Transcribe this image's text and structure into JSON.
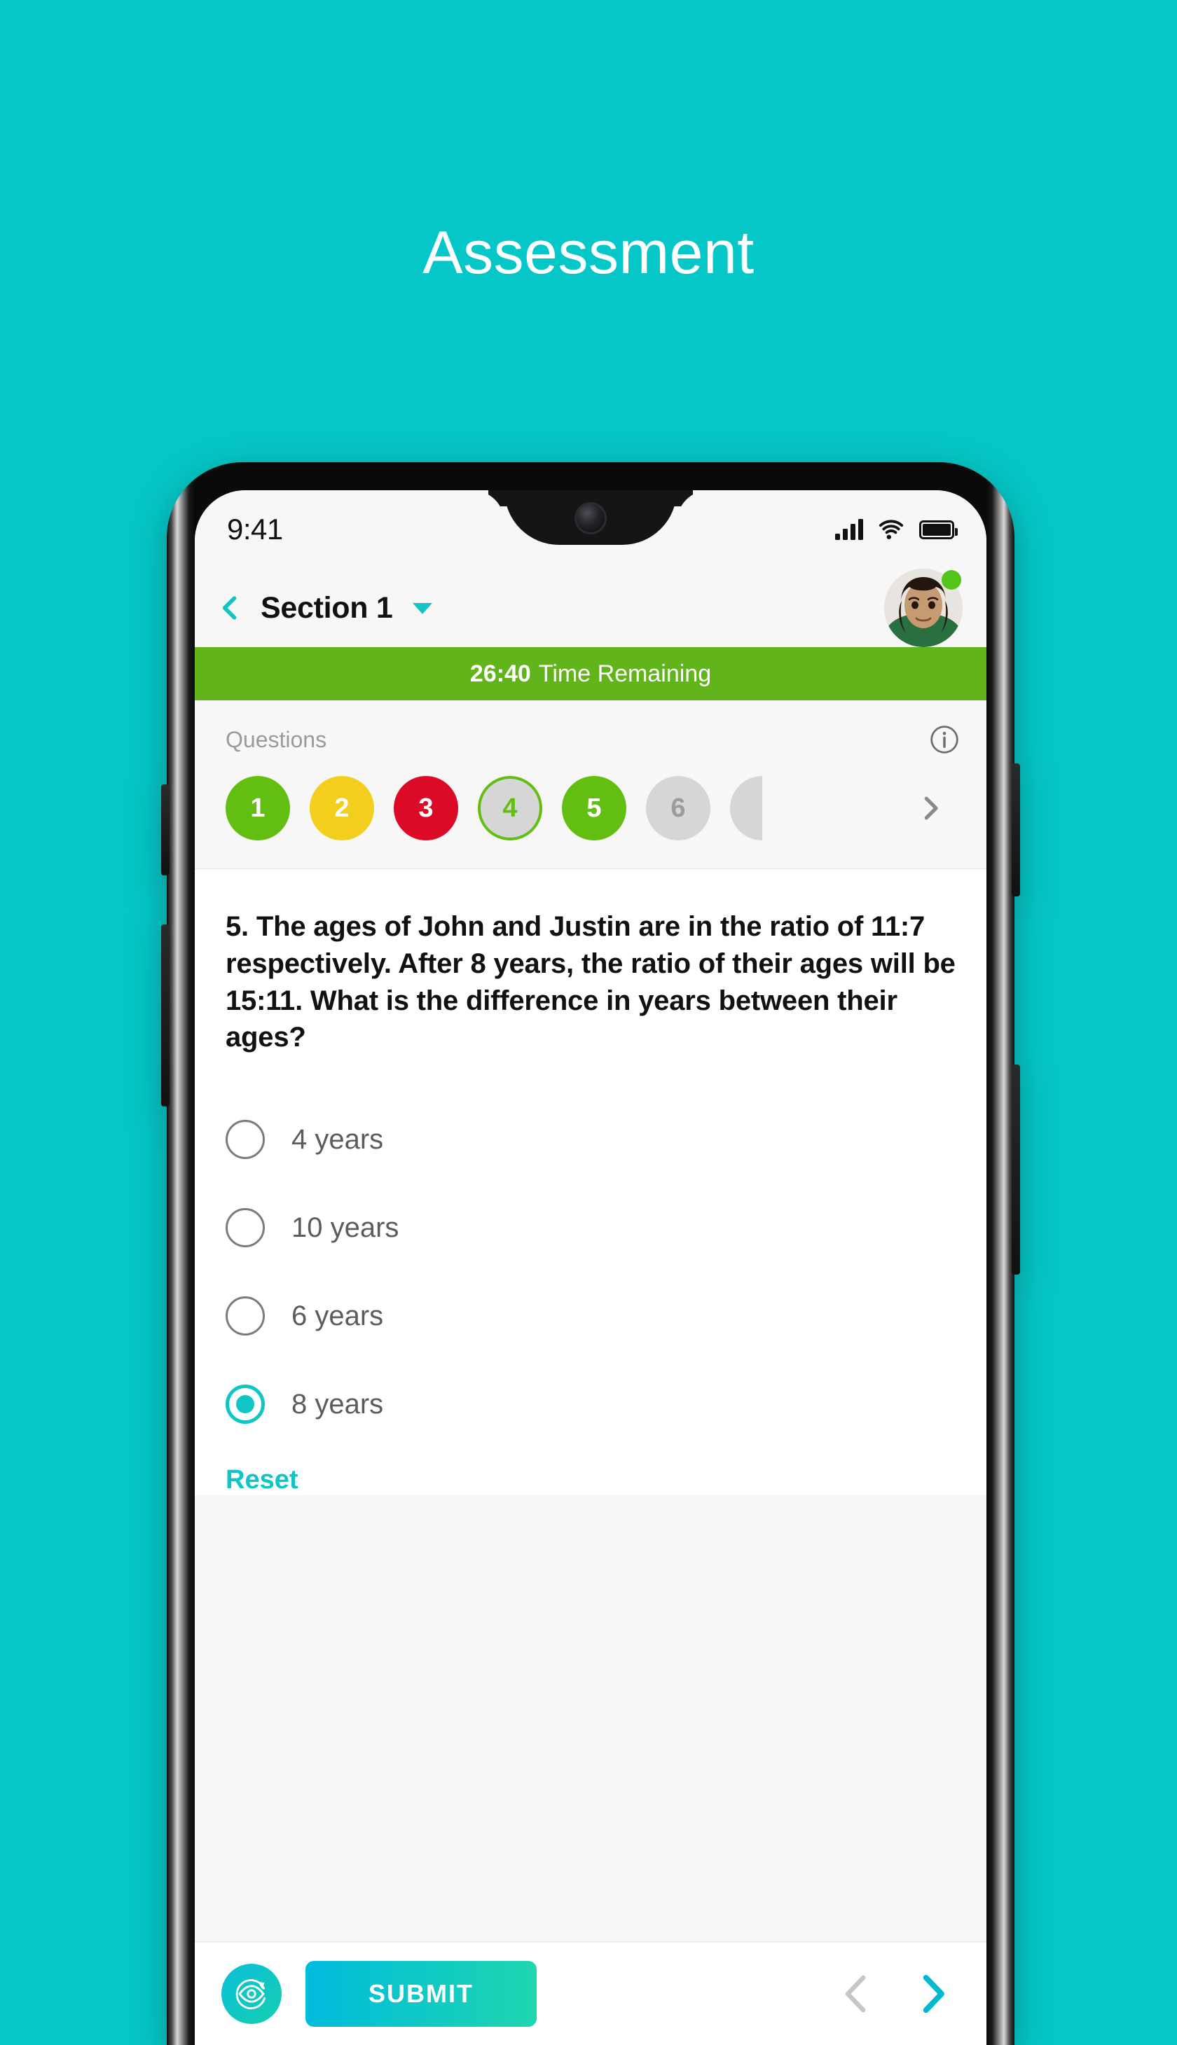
{
  "page": {
    "title": "Assessment",
    "background_color": "#06C7C7"
  },
  "status_bar": {
    "time": "9:41",
    "signal_icon": "signal-bars-icon",
    "wifi_icon": "wifi-icon",
    "battery_icon": "battery-full-icon"
  },
  "nav_bar": {
    "back_icon": "chevron-left-icon",
    "title": "Section 1",
    "dropdown_icon": "caret-down-icon",
    "avatar_icon": "user-avatar",
    "status_dot_color": "#52C41A",
    "accent_color": "#0FC5C5"
  },
  "timer": {
    "value": "26:40",
    "label": "Time Remaining",
    "background_color": "#61B51B"
  },
  "questions_strip": {
    "label": "Questions",
    "info_icon": "info-circle-icon",
    "next_icon": "chevron-right-icon",
    "items": [
      {
        "number": "1",
        "state": "green"
      },
      {
        "number": "2",
        "state": "amber"
      },
      {
        "number": "3",
        "state": "red"
      },
      {
        "number": "4",
        "state": "active"
      },
      {
        "number": "5",
        "state": "green"
      },
      {
        "number": "6",
        "state": "grey"
      },
      {
        "number": "",
        "state": "partial"
      }
    ],
    "colors": {
      "green": "#63BE12",
      "amber": "#F4CE1C",
      "red": "#DC0A26",
      "grey": "#D6D6D6"
    }
  },
  "question": {
    "text": "5. The ages of John and Justin are in the ratio of 11:7 respectively.\nAfter 8 years, the ratio of their ages will be 15:11. What is the difference in years between their ages?",
    "options": [
      {
        "label": "4 years",
        "selected": false
      },
      {
        "label": "10 years",
        "selected": false
      },
      {
        "label": "6 years",
        "selected": false
      },
      {
        "label": "8 years",
        "selected": true
      }
    ],
    "reset_label": "Reset"
  },
  "bottom_bar": {
    "review_icon": "review-eye-icon",
    "submit_label": "SUBMIT",
    "prev_icon": "chevron-left-icon",
    "next_icon": "chevron-right-icon",
    "prev_enabled": false,
    "next_enabled": true
  }
}
